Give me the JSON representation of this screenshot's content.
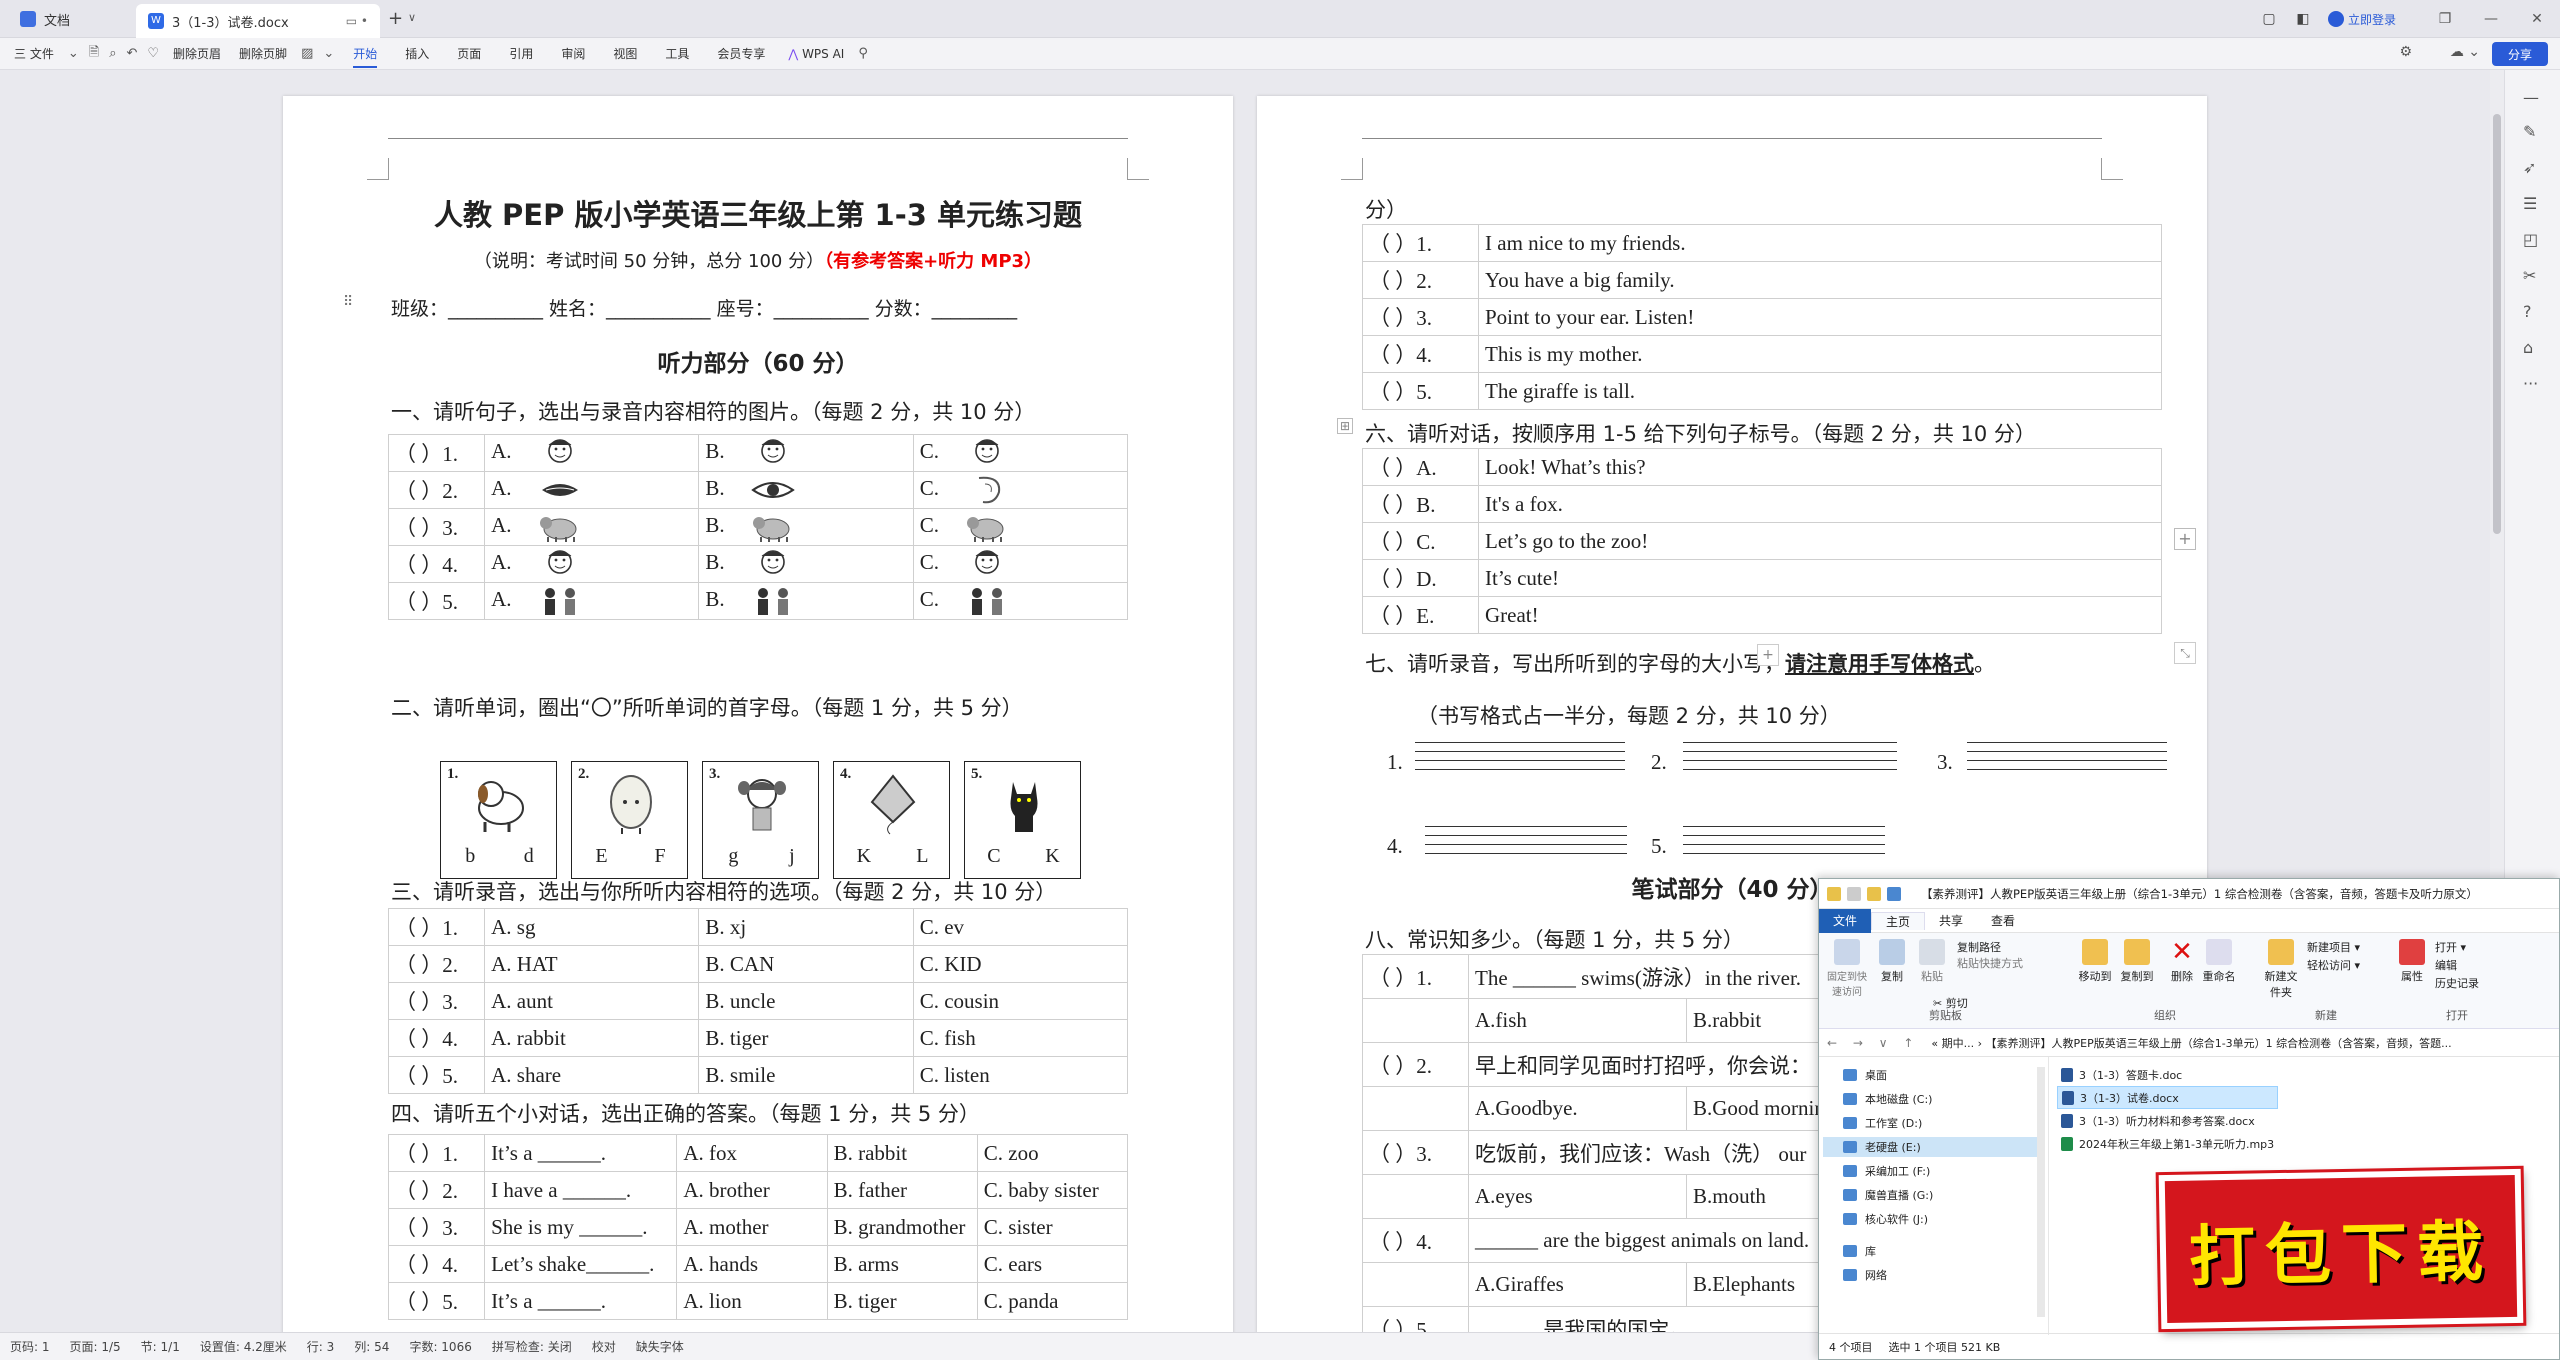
{
  "titlebar": {
    "home_tab": "文档",
    "doc_tab": "3（1-3）试卷.docx",
    "login": "立即登录"
  },
  "toolbar": {
    "file": "三 文件",
    "header_del": "删除页眉",
    "footer_del": "删除页脚",
    "tabs": [
      "开始",
      "插入",
      "页面",
      "引用",
      "审阅",
      "视图",
      "工具",
      "会员专享"
    ],
    "ai": "WPS AI",
    "share": "分享"
  },
  "page1": {
    "title": "人教 PEP 版小学英语三年级上第 1-3 单元练习题",
    "subtitle_a": "（说明：考试时间 50 分钟，总分 100 分）",
    "subtitle_b": "（有参考答案+听力 MP3）",
    "info": "班级：__________  姓名：___________  座号：__________  分数：_________",
    "part_listen": "听力部分（60 分）",
    "s1_title": "一、请听句子，选出与录音内容相符的图片。（每题 2 分，共 10 分）",
    "s1_rows": [
      {
        "num": "（     ）1.",
        "a": "A.",
        "b": "B.",
        "c": "C.",
        "icons": [
          "boy-head-icon",
          "teacher-head-icon",
          "girl-head-icon"
        ]
      },
      {
        "num": "（     ）2.",
        "a": "A.",
        "b": "B.",
        "c": "C.",
        "icons": [
          "mouth-icon",
          "eye-icon",
          "ear-icon"
        ]
      },
      {
        "num": "（     ）3.",
        "a": "A.",
        "b": "B.",
        "c": "C.",
        "icons": [
          "elephant-icon",
          "giraffe-icon",
          "lion-icon"
        ]
      },
      {
        "num": "（     ）4.",
        "a": "A.",
        "b": "B.",
        "c": "C.",
        "icons": [
          "panda-icon",
          "grandpa-icon",
          "teacher-icon"
        ]
      },
      {
        "num": "（     ）5.",
        "a": "A.",
        "b": "B.",
        "c": "C.",
        "icons": [
          "family-icon",
          "shaking-hands-icon",
          "classroom-icon"
        ]
      }
    ],
    "s2_title": "二、请听单词，圈出“〇”所听单词的首字母。（每题 1 分，共 5 分）",
    "s2_boxes": [
      {
        "n": "1.",
        "l1": "b",
        "l2": "d",
        "icon": "dog-icon"
      },
      {
        "n": "2.",
        "l1": "E",
        "l2": "F",
        "icon": "egg-icon"
      },
      {
        "n": "3.",
        "l1": "g",
        "l2": "j",
        "icon": "girl-icon"
      },
      {
        "n": "4.",
        "l1": "K",
        "l2": "L",
        "icon": "kite-icon"
      },
      {
        "n": "5.",
        "l1": "C",
        "l2": "K",
        "icon": "cat-icon"
      }
    ],
    "s3_title": "三、请听录音，选出与你所听内容相符的选项。（每题 2 分，共 10 分）",
    "s3_rows": [
      {
        "num": "（     ）1.",
        "a": "A.  sg",
        "b": "B.  xj",
        "c": "C.  ev"
      },
      {
        "num": "（     ）2.",
        "a": "A.  HAT",
        "b": "B.  CAN",
        "c": "C. KID"
      },
      {
        "num": "（     ）3.",
        "a": "A.  aunt",
        "b": "B. uncle",
        "c": "C. cousin"
      },
      {
        "num": "（     ）4.",
        "a": "A.  rabbit",
        "b": "B. tiger",
        "c": "C. fish"
      },
      {
        "num": "（     ）5.",
        "a": "A.  share",
        "b": "B. smile",
        "c": "C. listen"
      }
    ],
    "s4_title": "四、请听五个小对话，选出正确的答案。（每题 1 分，共 5 分）",
    "s4_rows": [
      {
        "num": "（     ）1.",
        "q": "It’s a ______.",
        "a": "A.  fox",
        "b": "B.  rabbit",
        "c": "C.  zoo"
      },
      {
        "num": "（     ）2.",
        "q": "I have a ______.",
        "a": "A.  brother",
        "b": "B.  father",
        "c": "C.  baby sister"
      },
      {
        "num": "（     ）3.",
        "q": "She is my ______.",
        "a": "A. mother",
        "b": "B. grandmother",
        "c": "C.  sister"
      },
      {
        "num": "（     ）4.",
        "q": "Let’s shake______.",
        "a": "A.  hands",
        "b": "B.  arms",
        "c": "C.  ears"
      },
      {
        "num": "（     ）5.",
        "q": "It’s a ______.",
        "a": "A.  lion",
        "b": "B.  tiger",
        "c": "C.  panda"
      }
    ]
  },
  "page2": {
    "cont": "分）",
    "s5_rows": [
      {
        "num": "（     ）1.",
        "t": "I am nice to my friends."
      },
      {
        "num": "（     ）2.",
        "t": "You have a big family."
      },
      {
        "num": "（     ）3.",
        "t": "Point to your ear. Listen!"
      },
      {
        "num": "（     ）4.",
        "t": "This is my mother."
      },
      {
        "num": "（     ）5.",
        "t": "The giraffe is tall."
      }
    ],
    "s6_title": "六、请听对话，按顺序用 1-5 给下列句子标号。（每题 2 分，共 10 分）",
    "s6_rows": [
      {
        "num": "（     ）A.",
        "t": "Look! What’s this?"
      },
      {
        "num": "（     ）B.",
        "t": "It's a fox."
      },
      {
        "num": "（     ）C.",
        "t": "Let’s go to the zoo!"
      },
      {
        "num": "（     ）D.",
        "t": "It’s cute!"
      },
      {
        "num": "（     ）E.",
        "t": "Great!"
      }
    ],
    "s7_title_a": "七、请听录音，写出所听到的字母的大小写，",
    "s7_title_b": "请注意用手写体格式",
    "s7_title_c": "。",
    "s7_note": "（书写格式占一半分，每题 2 分，共 10 分）",
    "s7_nums": [
      "1.",
      "2.",
      "3.",
      "4.",
      "5."
    ],
    "part_write": "笔试部分（40 分）",
    "s8_title": "八、常识知多少。（每题 1 分，共 5 分）",
    "s8_rows": [
      {
        "num": "（     ）1.",
        "q": "The ______  swims(游泳）in the river.",
        "a": "A.fish",
        "b": "B.rabbit"
      },
      {
        "num": "（     ）2.",
        "q": "早上和同学见面时打招呼，你会说：",
        "a": "A.Goodbye.",
        "b": "B.Good morning."
      },
      {
        "num": "（     ）3.",
        "q": "吃饭前，我们应该：Wash（洗） our",
        "a": "A.eyes",
        "b": "B.mouth"
      },
      {
        "num": "（     ）4.",
        "q": "______  are the biggest animals on land.",
        "a": "A.Giraffes",
        "b": "B.Elephants"
      },
      {
        "num": "（     ）5.",
        "q": "______ 是我国的国宝。",
        "a": "",
        "b": ""
      }
    ]
  },
  "statusbar": {
    "items": [
      "页码: 1",
      "页面: 1/5",
      "节: 1/1",
      "设置值: 4.2厘米",
      "行: 3",
      "列: 54",
      "字数: 1066",
      "拼写检查: 关闭",
      "校对",
      "缺失字体"
    ]
  },
  "explorer": {
    "title": "【素养测评】人教PEP版英语三年级上册（综合1-3单元）1 综合检测卷（含答案，音频，答题卡及听力原文）",
    "tabs": [
      "文件",
      "主页",
      "共享",
      "查看"
    ],
    "ribbon": {
      "pin": "固定到快速访问",
      "copy": "复制",
      "paste": "粘贴",
      "copy_path": "复制路径",
      "paste_shortcut": "粘贴快捷方式",
      "cut": "剪切",
      "clipboard": "剪贴板",
      "move_to": "移动到",
      "copy_to": "复制到",
      "delete": "删除",
      "rename": "重命名",
      "organize": "组织",
      "new_folder": "新建文件夹",
      "new_item": "新建项目",
      "easy_access": "轻松访问",
      "new": "新建",
      "properties": "属性",
      "open": "打开",
      "edit": "编辑",
      "history": "历史记录",
      "open_group": "打开"
    },
    "address": "« 期中... › 【素养测评】人教PEP版英语三年级上册（综合1-3单元）1 综合检测卷（含答案，音频，答题...",
    "nav": [
      "桌面",
      "本地磁盘 (C:)",
      "工作室 (D:)",
      "老硬盘 (E:)",
      "采编加工 (F:)",
      "魔兽直播 (G:)",
      "核心软件 (J:)",
      "库",
      "网络"
    ],
    "files": [
      "3（1-3）答题卡.doc",
      "3（1-3）试卷.docx",
      "3（1-3）听力材料和参考答案.docx",
      "2024年秋三年级上第1-3单元听力.mp3"
    ],
    "status": [
      "4 个项目",
      "选中 1 个项目  521 KB"
    ]
  },
  "badge": "打包下载"
}
